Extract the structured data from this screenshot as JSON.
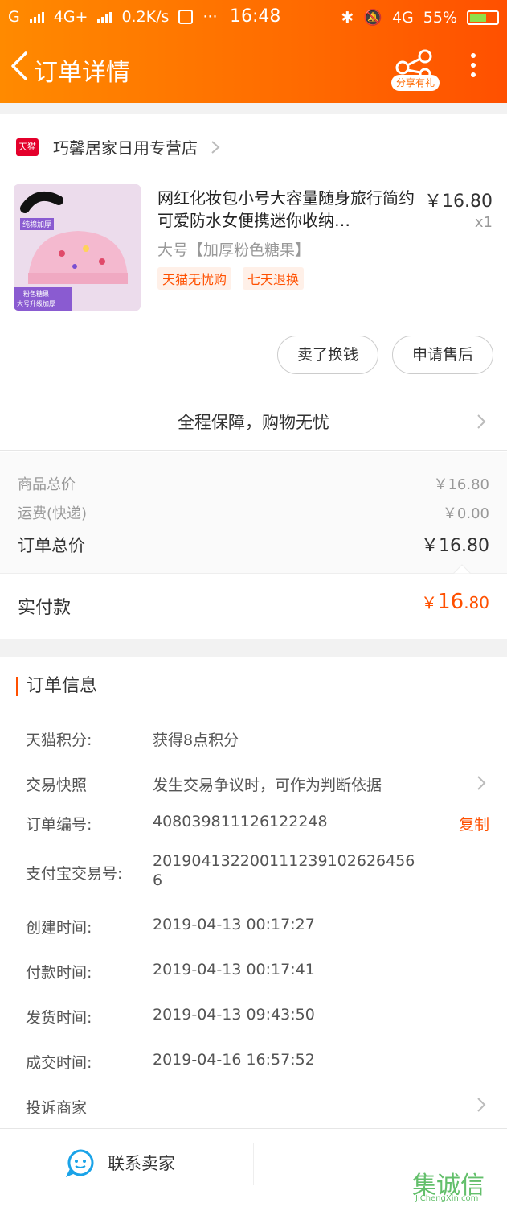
{
  "status_bar": {
    "carrier": "G",
    "net1": "4G+",
    "speed": "0.2K/s",
    "time": "16:48",
    "net2": "4G",
    "battery": "55%"
  },
  "header": {
    "title": "订单详情",
    "share_label": "分享有礼"
  },
  "store": {
    "badge": "天猫",
    "name": "巧馨居家日用专营店"
  },
  "product": {
    "title": "网红化妆包小号大容量随身旅行简约可爱防水女便携迷你收纳…",
    "price": "￥16.80",
    "qty": "x1",
    "sku": "大号【加厚粉色糖果】",
    "tags": [
      "天猫无忧购",
      "七天退换"
    ],
    "thumb_texts": [
      "纯棉加厚",
      "粉色糖果",
      "大号升级加厚"
    ]
  },
  "actions": {
    "resell": "卖了换钱",
    "after_sale": "申请售后"
  },
  "guarantee": "全程保障，购物无忧",
  "summary": {
    "goods_label": "商品总价",
    "goods_value": "￥16.80",
    "shipping_label": "运费(快递)",
    "shipping_value": "￥0.00",
    "total_label": "订单总价",
    "total_value": "￥16.80"
  },
  "paid": {
    "label": "实付款",
    "currency": "￥",
    "integer": "16",
    "decimal": ".80"
  },
  "order_info": {
    "title": "订单信息",
    "points_label": "天猫积分:",
    "points_value": "获得8点积分",
    "snapshot_label": "交易快照",
    "snapshot_value": "发生交易争议时，可作为判断依据",
    "order_no_label": "订单编号:",
    "order_no_value": "408039811126122248",
    "copy_label": "复制",
    "alipay_label": "支付宝交易号:",
    "alipay_value_1": "20190413220011123910262645​6",
    "alipay_value_2": "6",
    "created_label": "创建时间:",
    "created_value": "2019-04-13 00:17:27",
    "paid_label": "付款时间:",
    "paid_value": "2019-04-13 00:17:41",
    "shipped_label": "发货时间:",
    "shipped_value": "2019-04-13 09:43:50",
    "done_label": "成交时间:",
    "done_value": "2019-04-16 16:57:52",
    "complain_label": "投诉商家"
  },
  "bottom": {
    "contact": "联系卖家"
  },
  "watermark": {
    "text": "集诚信",
    "domain": "JiChengXin.com"
  },
  "colors": {
    "accent": "#ff5000",
    "header_start": "#ff8a00",
    "header_end": "#ff5000",
    "tmall_red": "#e4002b",
    "contact_icon": "#1aa3e8"
  }
}
